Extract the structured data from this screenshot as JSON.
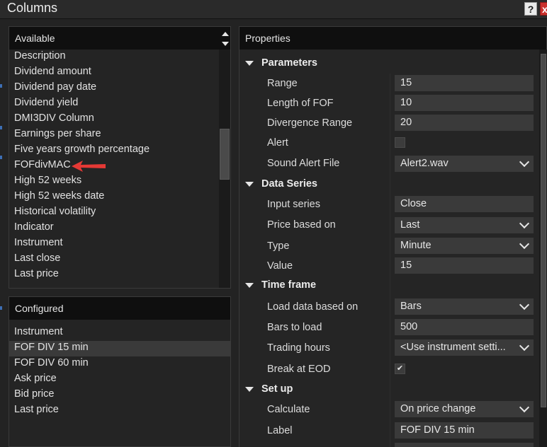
{
  "window": {
    "title": "Columns",
    "help_label": "?",
    "close_label": "x"
  },
  "available": {
    "header": "Available",
    "items": [
      "Description",
      "Dividend amount",
      "Dividend pay date",
      "Dividend yield",
      "DMI3DIV Column",
      "Earnings per share",
      "Five years growth percentage",
      "FOFdivMAC",
      "High 52 weeks",
      "High 52 weeks date",
      "Historical volatility",
      "Indicator",
      "Instrument",
      "Last close",
      "Last price"
    ],
    "highlighted_item": "FOFdivMAC",
    "annotation_color": "#e53935"
  },
  "configured": {
    "header": "Configured",
    "items": [
      "Instrument",
      "FOF DIV 15 min",
      "FOF DIV 60 min",
      "Ask price",
      "Bid price",
      "Last price"
    ],
    "selected_item": "FOF DIV 15 min"
  },
  "properties": {
    "header": "Properties",
    "parameters": {
      "label": "Parameters",
      "range_label": "Range",
      "range_value": "15",
      "length_label": "Length of FOF",
      "length_value": "10",
      "divergence_label": "Divergence Range",
      "divergence_value": "20",
      "alert_label": "Alert",
      "alert_checked": false,
      "sound_label": "Sound Alert File",
      "sound_value": "Alert2.wav"
    },
    "data_series": {
      "label": "Data Series",
      "input_label": "Input series",
      "input_value": "Close",
      "price_label": "Price based on",
      "price_value": "Last",
      "type_label": "Type",
      "type_value": "Minute",
      "value_label": "Value",
      "value_value": "15"
    },
    "time_frame": {
      "label": "Time frame",
      "load_label": "Load data based on",
      "load_value": "Bars",
      "bars_label": "Bars to load",
      "bars_value": "500",
      "hours_label": "Trading hours",
      "hours_value": "<Use instrument setti...",
      "eod_label": "Break at EOD",
      "eod_checked": true
    },
    "set_up": {
      "label": "Set up",
      "calc_label": "Calculate",
      "calc_value": "On price change",
      "label_label": "Label",
      "label_value": "FOF DIV 15 min"
    }
  },
  "checkmark": "✔"
}
